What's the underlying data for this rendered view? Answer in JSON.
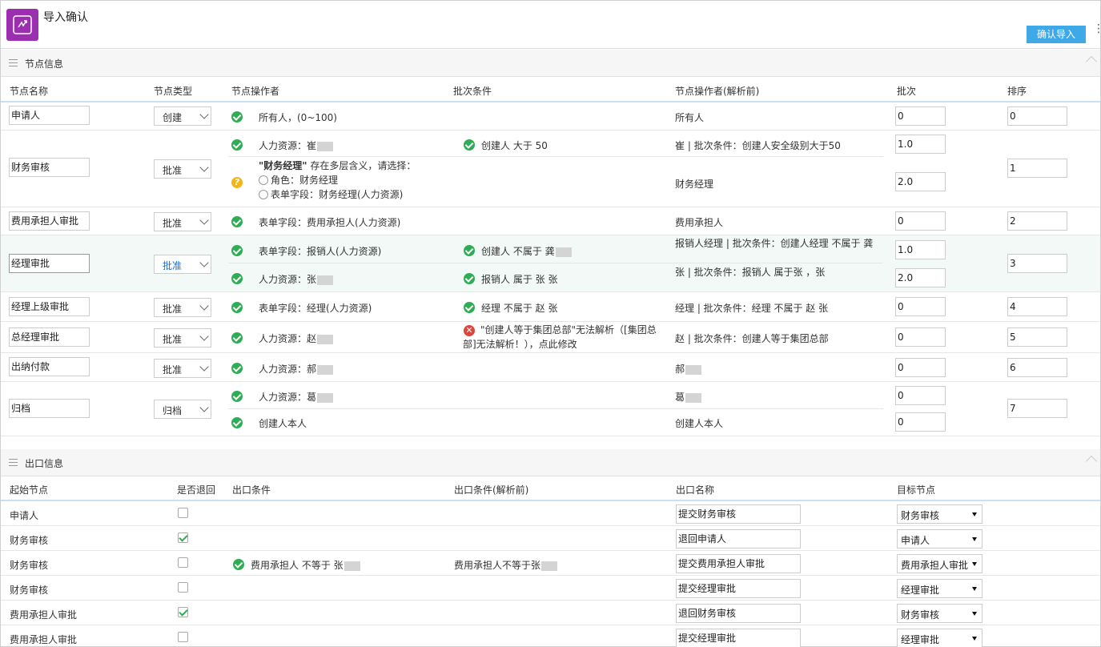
{
  "header": {
    "title": "导入确认",
    "confirm_label": "确认导入",
    "more": "⋮"
  },
  "node_section": {
    "title": "节点信息",
    "columns": [
      "节点名称",
      "节点类型",
      "节点操作者",
      "批次条件",
      "节点操作者(解析前)",
      "批次",
      "排序"
    ],
    "rows": [
      {
        "name": "申请人",
        "type": "创建",
        "ops": [
          {
            "status": "ok",
            "operator": "所有人，(0~100)",
            "cond_status": "",
            "cond": "",
            "before": "所有人",
            "batch": "0"
          }
        ],
        "order": "0"
      },
      {
        "name": "财务审核",
        "type": "批准",
        "ops": [
          {
            "status": "ok",
            "operator": "人力资源：崔",
            "cond_status": "ok",
            "cond": "创建人 大于 50",
            "before": "崔 | 批次条件：创建人安全级别大于50",
            "batch": "1.0"
          },
          {
            "status": "warn",
            "operator_bold": "\"财务经理\"",
            "operator": " 存在多层含义，请选择：",
            "opt1": "角色：财务经理",
            "opt2": "表单字段：财务经理(人力资源)",
            "cond_status": "",
            "cond": "",
            "before": "财务经理",
            "batch": "2.0"
          }
        ],
        "order": "1"
      },
      {
        "name": "费用承担人审批",
        "type": "批准",
        "ops": [
          {
            "status": "ok",
            "operator": "表单字段：费用承担人(人力资源)",
            "cond_status": "",
            "cond": "",
            "before": "费用承担人",
            "batch": "0"
          }
        ],
        "order": "2"
      },
      {
        "name": "经理审批",
        "type": "批准",
        "ops": [
          {
            "status": "ok",
            "operator": "表单字段：报销人(人力资源)",
            "cond_status": "ok",
            "cond": "创建人 不属于 龚",
            "before": "报销人经理 | 批次条件：创建人经理 不属于 龚",
            "batch": "1.0"
          },
          {
            "status": "ok",
            "operator": "人力资源：张",
            "cond_status": "ok",
            "cond": "报销人 属于 张 张",
            "before": "张 | 批次条件：报销人 属于张 ，张",
            "batch": "2.0"
          }
        ],
        "order": "3"
      },
      {
        "name": "经理上级审批",
        "type": "批准",
        "ops": [
          {
            "status": "ok",
            "operator": "表单字段：经理(人力资源)",
            "cond_status": "ok",
            "cond": "经理 不属于 赵 张",
            "before": "经理 | 批次条件：经理 不属于 赵 张",
            "batch": "0"
          }
        ],
        "order": "4"
      },
      {
        "name": "总经理审批",
        "type": "批准",
        "ops": [
          {
            "status": "ok",
            "operator": "人力资源：赵",
            "cond_status": "err",
            "cond": "\"创建人等于集团总部\"无法解析（[集团总部]无法解析！），点此修改",
            "before": "赵 | 批次条件：创建人等于集团总部",
            "batch": "0"
          }
        ],
        "order": "5"
      },
      {
        "name": "出纳付款",
        "type": "批准",
        "ops": [
          {
            "status": "ok",
            "operator": "人力资源：郝",
            "cond_status": "",
            "cond": "",
            "before": "郝",
            "batch": "0"
          }
        ],
        "order": "6"
      },
      {
        "name": "归档",
        "type": "归档",
        "ops": [
          {
            "status": "ok",
            "operator": "人力资源：葛",
            "cond_status": "",
            "cond": "",
            "before": "葛",
            "batch": "0"
          },
          {
            "status": "ok",
            "operator": "创建人本人",
            "cond_status": "",
            "cond": "",
            "before": "创建人本人",
            "batch": "0"
          }
        ],
        "order": "7"
      }
    ]
  },
  "exit_section": {
    "title": "出口信息",
    "columns": [
      "起始节点",
      "是否退回",
      "出口条件",
      "出口条件(解析前)",
      "出口名称",
      "目标节点"
    ],
    "rows": [
      {
        "start": "申请人",
        "returned": false,
        "cond": "",
        "cond_before": "",
        "exit_name": "提交财务审核",
        "target": "财务审核"
      },
      {
        "start": "财务审核",
        "returned": true,
        "cond": "",
        "cond_before": "",
        "exit_name": "退回申请人",
        "target": "申请人"
      },
      {
        "start": "财务审核",
        "returned": false,
        "cond": "费用承担人 不等于 张",
        "cond_before": "费用承担人不等于张",
        "exit_name": "提交费用承担人审批",
        "target": "费用承担人审批"
      },
      {
        "start": "财务审核",
        "returned": false,
        "cond": "",
        "cond_before": "",
        "exit_name": "提交经理审批",
        "target": "经理审批"
      },
      {
        "start": "费用承担人审批",
        "returned": true,
        "cond": "",
        "cond_before": "",
        "exit_name": "退回财务审核",
        "target": "财务审核"
      },
      {
        "start": "费用承担人审批",
        "returned": false,
        "cond": "",
        "cond_before": "",
        "exit_name": "提交经理审批",
        "target": "经理审批"
      }
    ]
  }
}
